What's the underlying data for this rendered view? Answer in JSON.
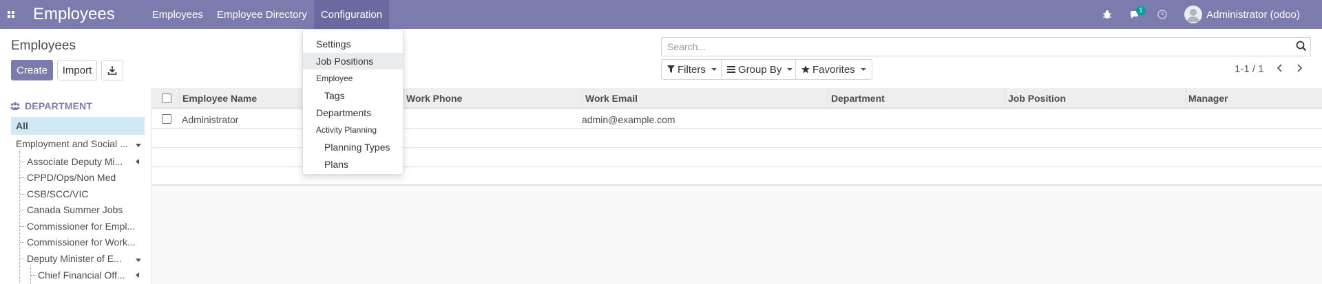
{
  "navbar": {
    "brand": "Employees",
    "menu": [
      "Employees",
      "Employee Directory",
      "Configuration"
    ],
    "active_menu": "Configuration",
    "messages_badge": "1",
    "user": "Administrator (odoo)",
    "bg_color": "#7c7bad"
  },
  "page": {
    "title": "Employees",
    "create_label": "Create",
    "import_label": "Import",
    "search_placeholder": "Search...",
    "filters_label": "Filters",
    "groupby_label": "Group By",
    "favorites_label": "Favorites",
    "pager": "1-1 / 1"
  },
  "sidebar": {
    "header": "DEPARTMENT",
    "all": "All",
    "items": [
      "Employment and Social ...",
      "Associate Deputy Mi...",
      "CPPD/Ops/Non Med",
      "CSB/SCC/VIC",
      "Canada Summer Jobs",
      "Commissioner for Empl...",
      "Commissioner for Work...",
      "Deputy Minister of E...",
      "Chief Financial Off..."
    ]
  },
  "table": {
    "columns": [
      "Employee Name",
      "Work Phone",
      "Work Email",
      "Department",
      "Job Position",
      "Manager"
    ],
    "rows": [
      {
        "name": "Administrator",
        "phone": "",
        "email": "admin@example.com",
        "department": "",
        "job": "",
        "manager": ""
      }
    ]
  },
  "config_menu": {
    "items": [
      "Settings",
      "Job Positions",
      "Employee",
      "Tags",
      "Departments",
      "Activity Planning",
      "Planning Types",
      "Plans"
    ],
    "highlighted": "Job Positions"
  }
}
